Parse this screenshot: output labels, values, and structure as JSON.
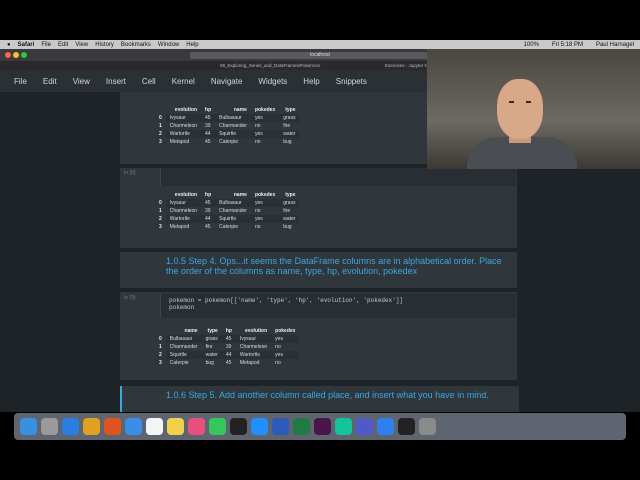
{
  "menubar": {
    "apple": "",
    "items": [
      "Safari",
      "File",
      "Edit",
      "View",
      "History",
      "Bookmarks",
      "Window",
      "Help"
    ],
    "clock": "Fri 5:18 PM",
    "user": "Paul Harnagel",
    "battery": "100%"
  },
  "browser": {
    "address": "localhost",
    "tabs": [
      "08_Exploring_Series_and_DataFrames/Pokemon/",
      "Exercises - Jupyter Notebook"
    ]
  },
  "jupyter_menu": [
    "File",
    "Edit",
    "View",
    "Insert",
    "Cell",
    "Kernel",
    "Navigate",
    "Widgets",
    "Help",
    "Snippets"
  ],
  "cells": {
    "table1": {
      "headers": [
        "",
        "evolution",
        "hp",
        "name",
        "pokedex",
        "type"
      ],
      "rows": [
        [
          "0",
          "Ivysaur",
          "45",
          "Bulbasaur",
          "yes",
          "grass"
        ],
        [
          "1",
          "Charmeleon",
          "39",
          "Charmander",
          "no",
          "fire"
        ],
        [
          "2",
          "Wartortle",
          "44",
          "Squirtle",
          "yes",
          "water"
        ],
        [
          "3",
          "Metapod",
          "45",
          "Caterpie",
          "no",
          "bug"
        ]
      ]
    },
    "prompt2": "In [8]:",
    "table2": {
      "headers": [
        "",
        "evolution",
        "hp",
        "name",
        "pokedex",
        "type"
      ],
      "rows": [
        [
          "0",
          "Ivysaur",
          "45",
          "Bulbasaur",
          "yes",
          "grass"
        ],
        [
          "1",
          "Charmeleon",
          "39",
          "Charmander",
          "no",
          "fire"
        ],
        [
          "2",
          "Wartortle",
          "44",
          "Squirtle",
          "yes",
          "water"
        ],
        [
          "3",
          "Metapod",
          "45",
          "Caterpie",
          "no",
          "bug"
        ]
      ]
    },
    "heading1": "1.0.5  Step 4. Ops...it seems the DataFrame columns are in alphabetical order. Place the order of the columns as name, type, hp, evolution, pokedex",
    "prompt3": "In [9]:",
    "code3_line1": "pokemon = pokemon[['name', 'type', 'hp', 'evolution', 'pokedex']]",
    "code3_line2": "pokemon",
    "table3": {
      "headers": [
        "",
        "name",
        "type",
        "hp",
        "evolution",
        "pokedex"
      ],
      "rows": [
        [
          "0",
          "Bulbasaur",
          "grass",
          "45",
          "Ivysaur",
          "yes"
        ],
        [
          "1",
          "Charmander",
          "fire",
          "39",
          "Charmeleon",
          "no"
        ],
        [
          "2",
          "Squirtle",
          "water",
          "44",
          "Wartortle",
          "yes"
        ],
        [
          "3",
          "Caterpie",
          "bug",
          "45",
          "Metapod",
          "no"
        ]
      ]
    },
    "heading2": "1.0.6  Step 5. Add another column called place, and insert what you have in mind."
  },
  "dock": [
    "Finder",
    "Launchpad",
    "Safari",
    "Chrome",
    "Brave",
    "Mail",
    "Calendar",
    "Notes",
    "Photos",
    "Messages",
    "TV",
    "App Store",
    "Word",
    "Excel",
    "Slack",
    "Grammarly",
    "Teams",
    "VS Code",
    "Terminal",
    "Trash"
  ],
  "colors": {
    "heading": "#3ba8e0",
    "notebook_bg": "#1e2327",
    "cell_bg": "#2f363c"
  }
}
